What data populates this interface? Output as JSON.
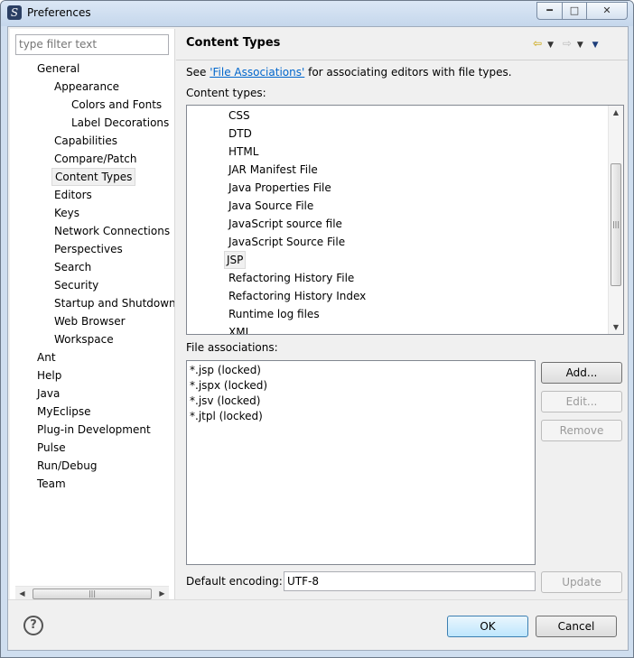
{
  "window": {
    "title": "Preferences"
  },
  "filter": {
    "placeholder": "type filter text"
  },
  "tree": [
    {
      "label": "General",
      "level": 0
    },
    {
      "label": "Appearance",
      "level": 1
    },
    {
      "label": "Colors and Fonts",
      "level": 2
    },
    {
      "label": "Label Decorations",
      "level": 2
    },
    {
      "label": "Capabilities",
      "level": 1
    },
    {
      "label": "Compare/Patch",
      "level": 1
    },
    {
      "label": "Content Types",
      "level": 1,
      "selected": true
    },
    {
      "label": "Editors",
      "level": 1
    },
    {
      "label": "Keys",
      "level": 1
    },
    {
      "label": "Network Connections",
      "level": 1
    },
    {
      "label": "Perspectives",
      "level": 1
    },
    {
      "label": "Search",
      "level": 1
    },
    {
      "label": "Security",
      "level": 1
    },
    {
      "label": "Startup and Shutdown",
      "level": 1
    },
    {
      "label": "Web Browser",
      "level": 1
    },
    {
      "label": "Workspace",
      "level": 1
    },
    {
      "label": "Ant",
      "level": 0
    },
    {
      "label": "Help",
      "level": 0
    },
    {
      "label": "Java",
      "level": 0
    },
    {
      "label": "MyEclipse",
      "level": 0
    },
    {
      "label": "Plug-in Development",
      "level": 0
    },
    {
      "label": "Pulse",
      "level": 0
    },
    {
      "label": "Run/Debug",
      "level": 0
    },
    {
      "label": "Team",
      "level": 0
    }
  ],
  "page": {
    "title": "Content Types",
    "desc_prefix": "See ",
    "desc_link": "'File Associations'",
    "desc_suffix": " for associating editors with file types.",
    "content_types_label": "Content types:",
    "file_assoc_label": "File associations:",
    "encoding_label": "Default encoding:",
    "encoding_value": "UTF-8"
  },
  "content_types": [
    {
      "label": "CSS"
    },
    {
      "label": "DTD"
    },
    {
      "label": "HTML"
    },
    {
      "label": "JAR Manifest File"
    },
    {
      "label": "Java Properties File"
    },
    {
      "label": "Java Source File"
    },
    {
      "label": "JavaScript source file"
    },
    {
      "label": "JavaScript Source File"
    },
    {
      "label": "JSP",
      "selected": true
    },
    {
      "label": "Refactoring History File"
    },
    {
      "label": "Refactoring History Index"
    },
    {
      "label": "Runtime log files"
    },
    {
      "label": "XML"
    }
  ],
  "file_associations": [
    "*.jsp (locked)",
    "*.jspx (locked)",
    "*.jsv (locked)",
    "*.jtpl (locked)"
  ],
  "buttons": {
    "add": "Add...",
    "edit": "Edit...",
    "remove": "Remove",
    "update": "Update",
    "ok": "OK",
    "cancel": "Cancel"
  },
  "icons": {
    "help": "?",
    "scroll_left": "◀",
    "scroll_right": "▶",
    "scroll_up": "▲",
    "scroll_down": "▼",
    "grip": "|||"
  }
}
